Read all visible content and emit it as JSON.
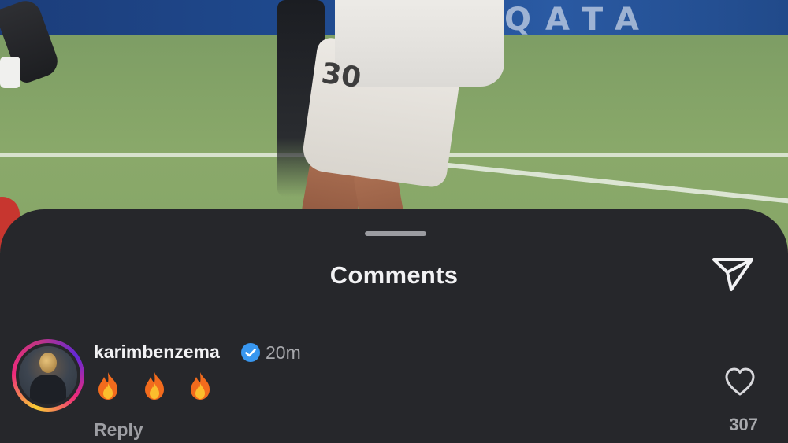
{
  "background": {
    "description_icon": "video-frame",
    "banner_text": "QATA",
    "shorts_number": "30"
  },
  "sheet": {
    "title": "Comments",
    "share_icon": "send-icon",
    "background_color": "#26272b"
  },
  "comments": [
    {
      "username": "karimbenzema",
      "verified": true,
      "verified_color": "#3897f0",
      "timestamp": "20m",
      "text": "🔥 🔥 🔥",
      "emoji_icons": [
        "fire-icon",
        "fire-icon",
        "fire-icon"
      ],
      "reply_label": "Reply",
      "like_icon": "heart-outline-icon",
      "like_count": "307"
    }
  ]
}
